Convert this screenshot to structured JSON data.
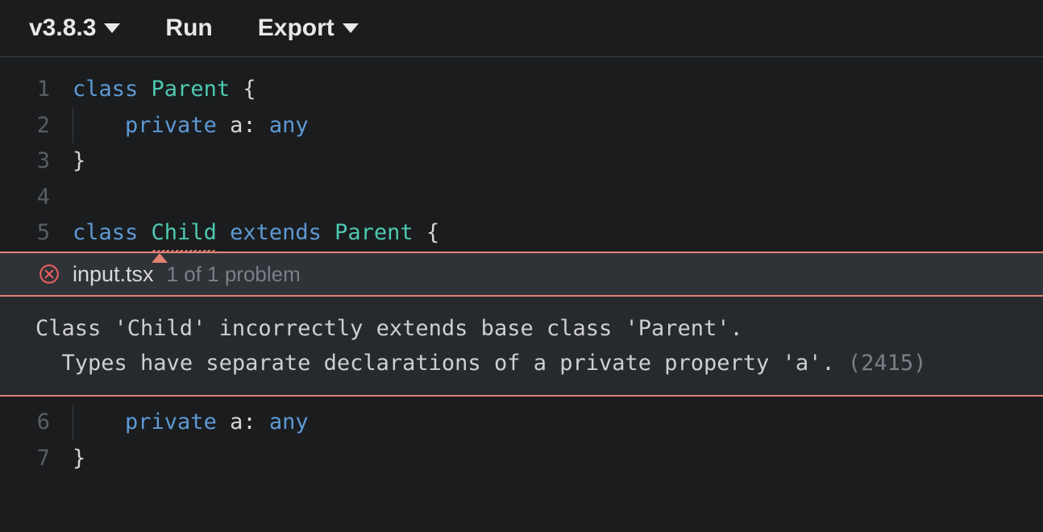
{
  "toolbar": {
    "version": "v3.8.3",
    "run": "Run",
    "export": "Export"
  },
  "code": {
    "lines": [
      {
        "n": "1"
      },
      {
        "n": "2"
      },
      {
        "n": "3"
      },
      {
        "n": "4"
      },
      {
        "n": "5"
      },
      {
        "n": "6"
      },
      {
        "n": "7"
      }
    ],
    "l1": {
      "kw": "class",
      "name": "Parent",
      "open": " {"
    },
    "l2": {
      "pad": "    ",
      "mod": "private",
      "id": " a",
      "colon": ": ",
      "type": "any"
    },
    "l3": {
      "close": "}"
    },
    "l5": {
      "kw": "class",
      "name": "Child",
      "ext": "extends",
      "parent": "Parent",
      "open": " {"
    },
    "l6": {
      "pad": "    ",
      "mod": "private",
      "id": " a",
      "colon": ": ",
      "type": "any"
    },
    "l7": {
      "close": "}"
    }
  },
  "error": {
    "filename": "input.tsx",
    "count": "1 of 1 problem",
    "line1": "Class 'Child' incorrectly extends base class 'Parent'.",
    "line2_pad": "  ",
    "line2": "Types have separate declarations of a private property 'a'.",
    "code": "(2415)"
  }
}
